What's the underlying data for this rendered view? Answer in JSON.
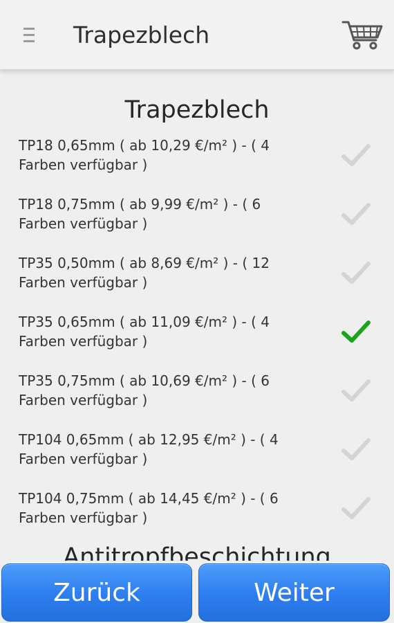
{
  "appbar": {
    "title": "Trapezblech",
    "menu_icon": "hamburger-menu-icon",
    "cart_icon": "shopping-cart-icon"
  },
  "section": {
    "title": "Trapezblech"
  },
  "products": [
    {
      "label": "TP18 0,65mm ( ab 10,29 €/m² ) - ( 4 Farben verfügbar )",
      "selected": false
    },
    {
      "label": "TP18 0,75mm ( ab 9,99 €/m² ) - ( 6 Farben verfügbar )",
      "selected": false
    },
    {
      "label": "TP35 0,50mm ( ab 8,69 €/m² ) - ( 12 Farben verfügbar )",
      "selected": false
    },
    {
      "label": "TP35 0,65mm ( ab 11,09 €/m² ) - ( 4 Farben verfügbar )",
      "selected": true
    },
    {
      "label": "TP35 0,75mm ( ab 10,69 €/m² ) - ( 6 Farben verfügbar )",
      "selected": false
    },
    {
      "label": "TP104 0,65mm ( ab 12,95 €/m² ) - ( 4 Farben verfügbar )",
      "selected": false
    },
    {
      "label": "TP104 0,75mm ( ab 14,45 €/m² ) - ( 6 Farben verfügbar )",
      "selected": false
    }
  ],
  "next_section": {
    "title": "Antitropfbeschichtung"
  },
  "footer": {
    "back_label": "Zurück",
    "next_label": "Weiter"
  },
  "colors": {
    "check_selected": "#1aa41a",
    "check_unselected": "#d4d4d4",
    "button_blue": "#2f7ff0"
  }
}
